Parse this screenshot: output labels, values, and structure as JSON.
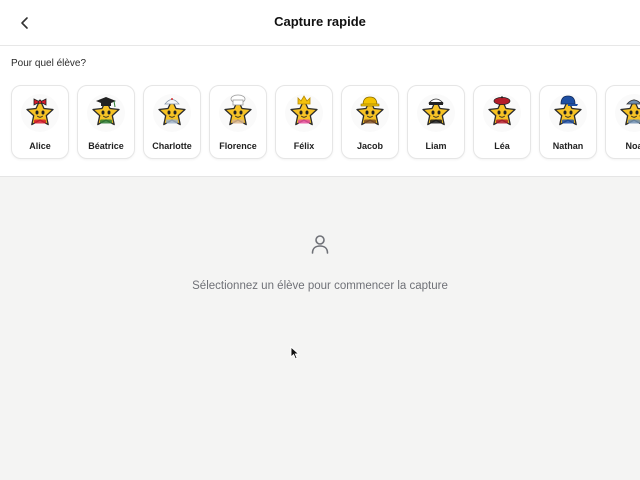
{
  "header": {
    "title": "Capture rapide",
    "back_icon": "chevron-left-icon"
  },
  "picker": {
    "label": "Pour quel élève?",
    "students": [
      {
        "name": "Alice",
        "accessory": "bow",
        "accent": "#d81b2c"
      },
      {
        "name": "Béatrice",
        "accessory": "grad-cap",
        "accent": "#2e7d32"
      },
      {
        "name": "Charlotte",
        "accessory": "nurse-cap",
        "accent": "#9fb2c8"
      },
      {
        "name": "Florence",
        "accessory": "chef-hat",
        "accent": "#d9b48a"
      },
      {
        "name": "Félix",
        "accessory": "crown",
        "accent": "#e84c9a"
      },
      {
        "name": "Jacob",
        "accessory": "hard-hat",
        "accent": "#7b4a1e"
      },
      {
        "name": "Liam",
        "accessory": "captain-hat",
        "accent": "#1a1a1a"
      },
      {
        "name": "Léa",
        "accessory": "beret",
        "accent": "#b51d2a"
      },
      {
        "name": "Nathan",
        "accessory": "cap",
        "accent": "#1e4fa3"
      },
      {
        "name": "Noa",
        "accessory": "hat",
        "accent": "#6f8eb0"
      }
    ]
  },
  "empty_state": {
    "icon": "person-icon",
    "message": "Sélectionnez un élève pour commencer la capture"
  },
  "colors": {
    "star": "#f7c325",
    "star_outline": "#2b2b2b",
    "background": "#f4f4f3",
    "muted_text": "#6f7177"
  }
}
